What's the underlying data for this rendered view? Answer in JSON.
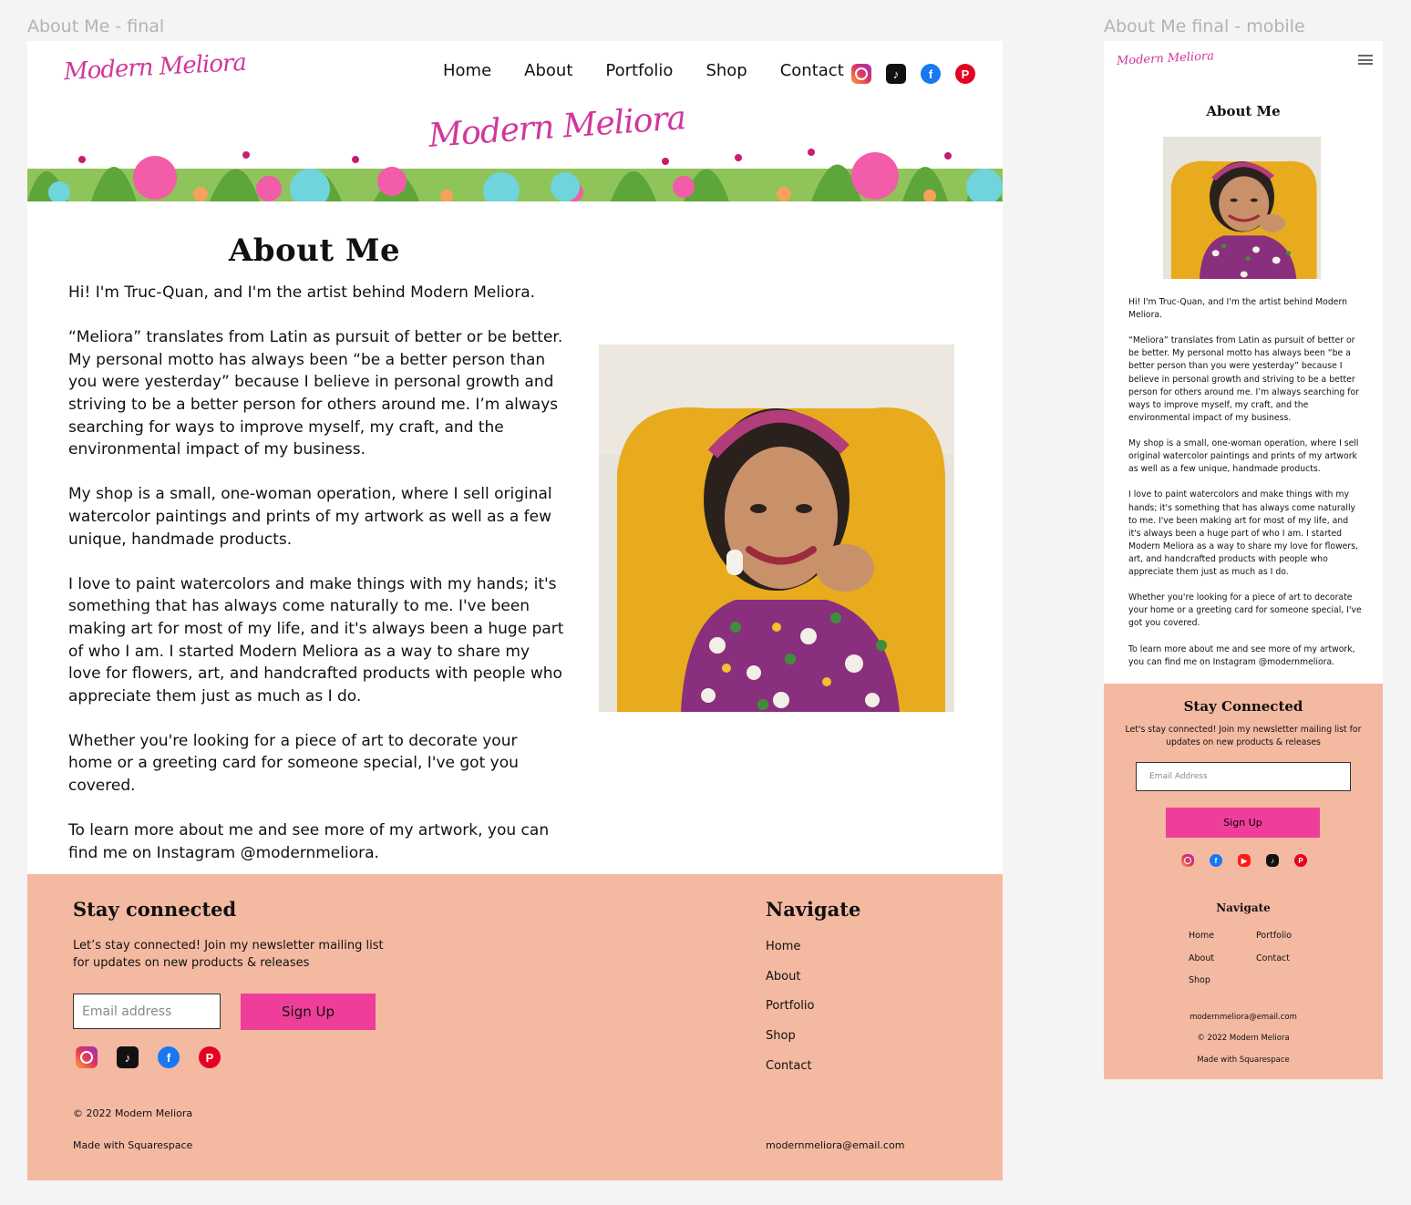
{
  "frames": {
    "desktop_label": "About Me - final",
    "mobile_label": "About Me final - mobile"
  },
  "brand": {
    "name": "Modern Meliora",
    "accent_color": "#d0379c",
    "button_color": "#ef3e9a",
    "footer_color": "#f4b9a1"
  },
  "nav": {
    "items": [
      {
        "label": "Home"
      },
      {
        "label": "About"
      },
      {
        "label": "Portfolio"
      },
      {
        "label": "Shop"
      },
      {
        "label": "Contact"
      }
    ]
  },
  "social_icons": [
    "instagram-icon",
    "tiktok-icon",
    "facebook-icon",
    "pinterest-icon"
  ],
  "mobile_social_icons": [
    "instagram-icon",
    "facebook-icon",
    "youtube-icon",
    "tiktok-icon",
    "pinterest-icon"
  ],
  "about": {
    "title": "About Me",
    "paragraphs": [
      "Hi! I'm Truc-Quan, and I'm the artist behind Modern Meliora.",
      "“Meliora” translates from Latin as pursuit of better or be better. My personal motto has always been “be a better person than you were yesterday” because I believe in personal growth and striving to be a better person for others around me. I’m always searching for ways to improve myself, my craft, and the environmental impact of my business.",
      "My shop is a small, one-woman operation, where I sell original watercolor paintings and prints of my artwork as well as a few unique, handmade products.",
      "I love to paint watercolors and make things with my hands; it's something that has always come naturally to me. I've been making art for most of my life, and it's always been a huge part of who I am. I started Modern Meliora as a way to share my love for flowers, art, and handcrafted products with people who appreciate them just as much as I do.",
      "Whether you're looking for a piece of art to decorate your home or a greeting card for someone special, I've got you covered.",
      "To learn more about me and see more of my artwork, you can find me on Instagram @modernmeliora."
    ]
  },
  "footer": {
    "stay_title": "Stay connected",
    "blurb": "Let’s stay connected! Join my newsletter mailing list for updates on new products & releases",
    "email_placeholder": "Email address",
    "signup_label": "Sign Up",
    "copyright": "© 2022 Modern Meliora",
    "made_with": "Made with Squarespace",
    "navigate_title": "Navigate",
    "email": "modernmeliora@email.com"
  },
  "mobile_footer": {
    "stay_title": "Stay Connected",
    "blurb": "Let's stay connected! Join my newsletter mailing list for updates on new products & releases",
    "email_placeholder": "Email Address",
    "signup_label": "Sign Up",
    "navigate_title": "Navigate",
    "nav_items": [
      "Home",
      "Portfolio",
      "About",
      "Contact",
      "Shop"
    ],
    "email": "modernmeliora@email.com",
    "copyright": "© 2022 Modern Meliora",
    "made_with": "Made with Squarespace"
  }
}
